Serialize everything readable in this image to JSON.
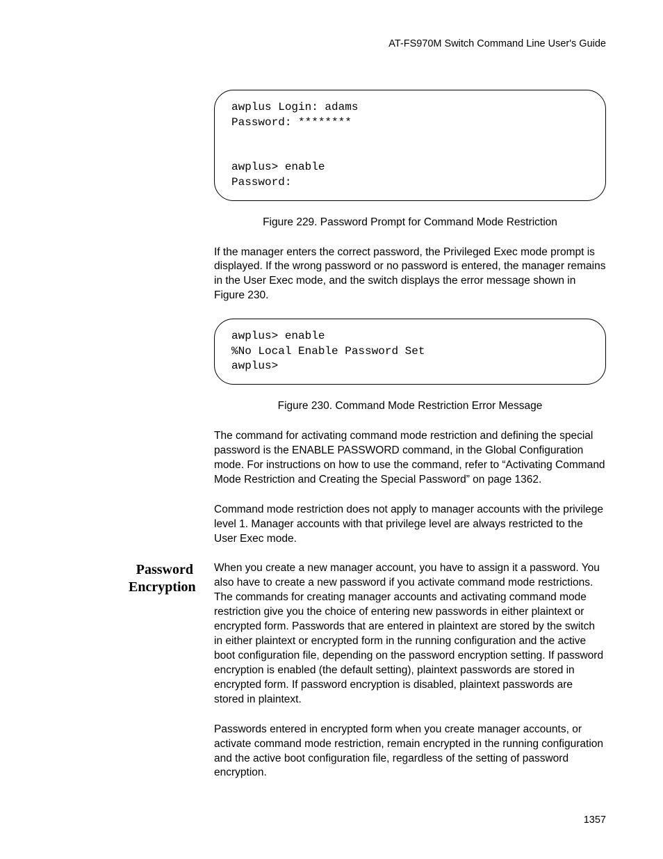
{
  "header": "AT-FS970M Switch Command Line User's Guide",
  "codebox1": "awplus Login: adams\nPassword: ********\n\n\nawplus> enable\nPassword:",
  "caption1": "Figure 229. Password Prompt for Command Mode Restriction",
  "para1": "If the manager enters the correct password, the Privileged Exec mode prompt is displayed. If the wrong password or no password is entered, the manager remains in the User Exec mode, and the switch displays the error message shown in Figure 230.",
  "codebox2": "awplus> enable\n%No Local Enable Password Set\nawplus>",
  "caption2": "Figure 230. Command Mode Restriction Error Message",
  "para2": "The command for activating command mode restriction and defining the special password is the ENABLE PASSWORD command, in the Global Configuration mode. For instructions on how to use the command, refer to “Activating Command Mode Restriction and Creating the Special Password” on page 1362.",
  "para3": "Command mode restriction does not apply to manager accounts with the privilege level 1. Manager accounts with that privilege level are always restricted to the User Exec mode.",
  "section_heading_line1": "Password",
  "section_heading_line2": "Encryption",
  "para4": "When you create a new manager account, you have to assign it a password. You also have to create a new password if you activate command mode restrictions. The commands for creating manager accounts and activating command mode restriction give you the choice of entering new passwords in either plaintext or encrypted form. Passwords that are entered in plaintext are stored by the switch in either plaintext or encrypted form in the running configuration and the active boot configuration file, depending on the password encryption setting. If password encryption is enabled (the default setting), plaintext passwords are stored in encrypted form. If password encryption is disabled, plaintext passwords are stored in plaintext.",
  "para5": "Passwords entered in encrypted form when you create manager accounts, or activate command mode restriction, remain encrypted in the running configuration and the active boot configuration file, regardless of the setting of password encryption.",
  "page_number": "1357"
}
